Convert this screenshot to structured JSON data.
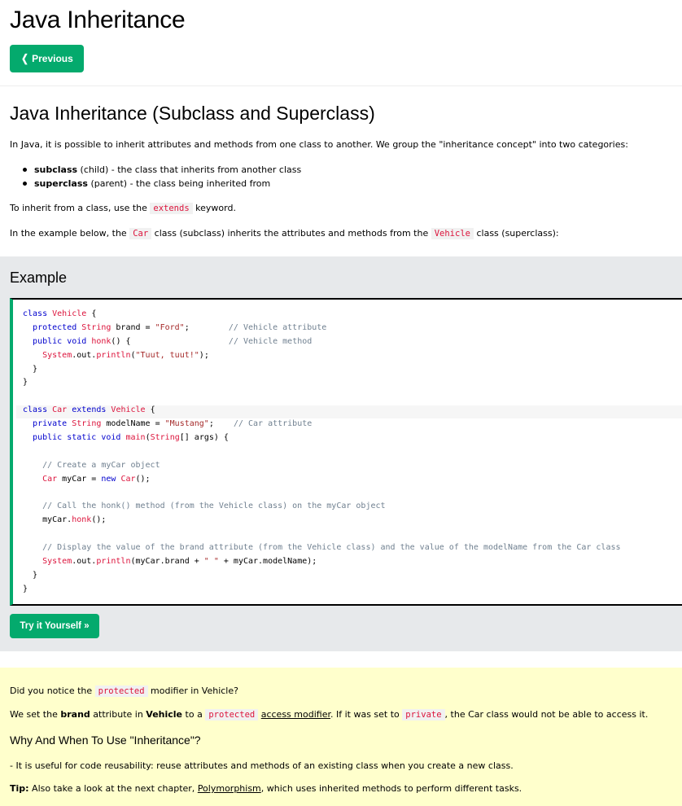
{
  "page": {
    "title": "Java Inheritance"
  },
  "nav": {
    "previous_label": "Previous",
    "previous_icon": "chevron-left-icon"
  },
  "section": {
    "title": "Java Inheritance (Subclass and Superclass)",
    "intro": "In Java, it is possible to inherit attributes and methods from one class to another. We group the \"inheritance concept\" into two categories:",
    "list": [
      {
        "term": "subclass",
        "desc": " (child) - the class that inherits from another class"
      },
      {
        "term": "superclass",
        "desc": " (parent) - the class being inherited from"
      }
    ],
    "extends_prefix": "To inherit from a class, use the ",
    "extends_code": "extends",
    "extends_suffix": " keyword.",
    "example_prefix": "In the example below, the ",
    "example_car": "Car",
    "example_middle": " class (subclass) inherits the attributes and methods from the ",
    "example_vehicle": "Vehicle",
    "example_suffix": " class (superclass):"
  },
  "example": {
    "heading": "Example",
    "try_label": "Try it Yourself »",
    "code_lines": [
      "class Vehicle {",
      "  protected String brand = \"Ford\";        // Vehicle attribute",
      "  public void honk() {                    // Vehicle method",
      "    System.out.println(\"Tuut, tuut!\");",
      "  }",
      "}",
      "",
      "class Car extends Vehicle {",
      "  private String modelName = \"Mustang\";    // Car attribute",
      "  public static void main(String[] args) {",
      "",
      "    // Create a myCar object",
      "    Car myCar = new Car();",
      "",
      "    // Call the honk() method (from the Vehicle class) on the myCar object",
      "    myCar.honk();",
      "",
      "    // Display the value of the brand attribute (from the Vehicle class) and the value of the modelName from the Car class",
      "    System.out.println(myCar.brand + \" \" + myCar.modelName);",
      "  }",
      "}"
    ]
  },
  "note": {
    "q_prefix": "Did you notice the ",
    "q_code": "protected",
    "q_suffix": " modifier in Vehicle?",
    "b_1": "We set the ",
    "b_brand": "brand",
    "b_2": " attribute in ",
    "b_vehicle": "Vehicle",
    "b_3": " to a ",
    "b_code1": "protected",
    "b_4": " ",
    "b_link": "access modifier",
    "b_5": ". If it was set to ",
    "b_code2": "private",
    "b_6": ", the Car class would not be able to access it.",
    "why_heading": "Why And When To Use \"Inheritance\"?",
    "reuse": "- It is useful for code reusability: reuse attributes and methods of an existing class when you create a new class.",
    "tip_label": "Tip:",
    "tip_1": " Also take a look at the next chapter, ",
    "tip_link": "Polymorphism",
    "tip_2": ", which uses inherited methods to perform different tasks."
  },
  "colors": {
    "accent": "#04AA6D",
    "code_panel_bg": "#E7E9EB",
    "note_bg": "#FFFFCC",
    "inline_code": "#DC143C"
  }
}
